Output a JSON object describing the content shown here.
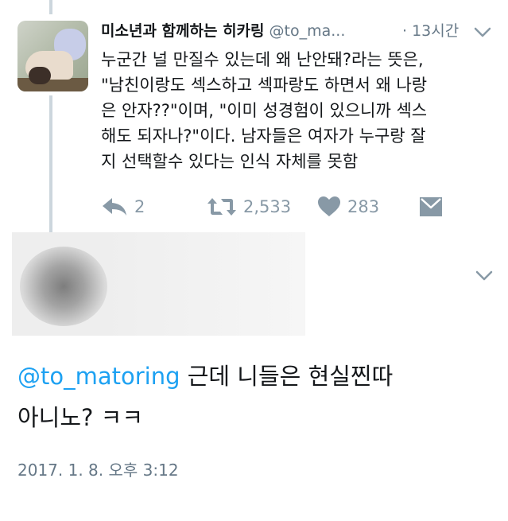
{
  "tweet": {
    "author_name": "미소년과 함께하는 히카링",
    "handle": "@to_ma...",
    "time": "· 13시간",
    "lines": [
      "누군간 널 만질수 있는데 왜 난안돼?라는 뜻은,",
      "\"남친이랑도 섹스하고 섹파랑도 하면서 왜 나랑",
      "은 안자??\"이며, \"이미 성경험이 있으니까 섹스",
      "해도 되자나?\"이다. 남자들은 여자가 누구랑 잘",
      "지 선택할수 있다는 인식 자체를 못함"
    ],
    "actions": {
      "reply_icon": "reply-arrow-icon",
      "reply_count": "2",
      "retweet_icon": "retweet-icon",
      "retweet_count": "2,533",
      "like_icon": "heart-icon",
      "like_count": "283",
      "dm_icon": "envelope-icon"
    }
  },
  "reply": {
    "mention": "@to_matoring",
    "text_line1": " 근데 니들은 현실찐따",
    "text_line2": "아니노? ㅋㅋ",
    "date": "2017. 1. 8. 오후 3:12"
  },
  "colors": {
    "accent": "#1da1f2",
    "muted": "#8899a6",
    "secondary_text": "#657786",
    "thread_line": "#ccd6dd"
  }
}
